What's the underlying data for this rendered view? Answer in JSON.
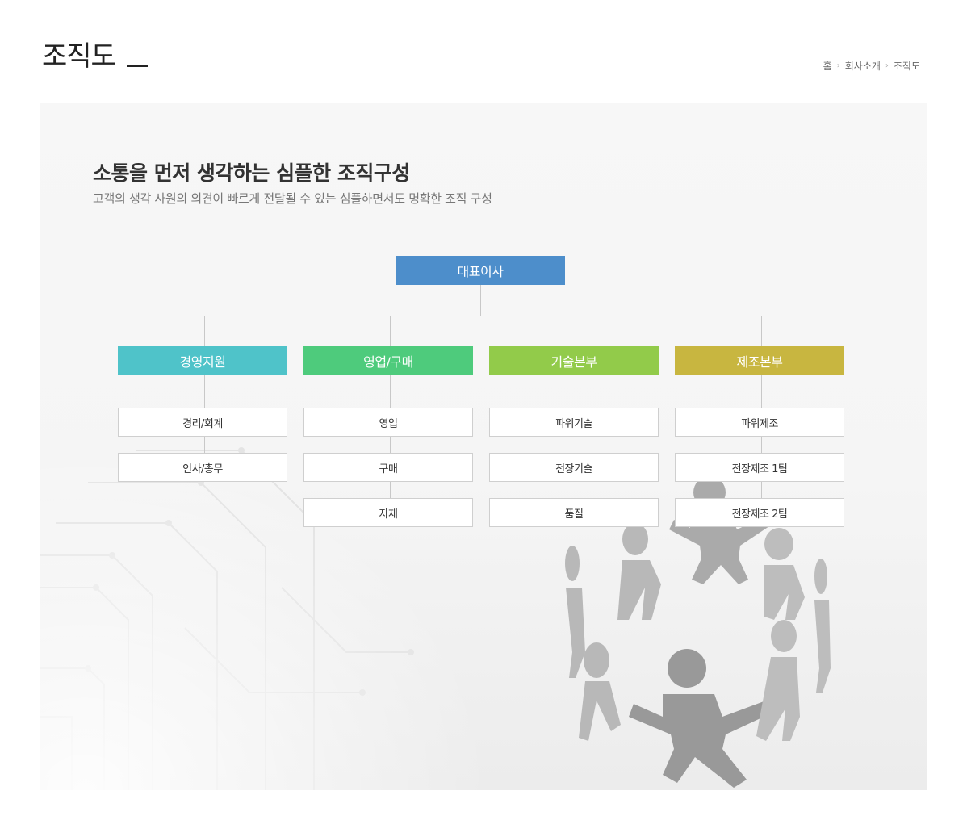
{
  "page": {
    "title": "조직도"
  },
  "breadcrumb": {
    "items": [
      "홈",
      "회사소개",
      "조직도"
    ]
  },
  "intro": {
    "headline": "소통을 먼저 생각하는 심플한 조직구성",
    "subline": "고객의 생각 사원의 의견이 빠르게 전달될 수 있는 심플하면서도 명확한 조직 구성"
  },
  "org": {
    "top": {
      "label": "대표이사",
      "color": "#4d8ecb"
    },
    "departments": [
      {
        "label": "경영지원",
        "color": "#4fc3c9",
        "teams": [
          "경리/회계",
          "인사/총무"
        ]
      },
      {
        "label": "영업/구매",
        "color": "#4ecb7c",
        "teams": [
          "영업",
          "구매",
          "자재"
        ]
      },
      {
        "label": "기술본부",
        "color": "#92cb4a",
        "teams": [
          "파워기술",
          "전장기술",
          "품질"
        ]
      },
      {
        "label": "제조본부",
        "color": "#c8b640",
        "teams": [
          "파워제조",
          "전장제조 1팀",
          "전장제조 2팀"
        ]
      }
    ]
  },
  "colors": {
    "connector": "#c8c8c8",
    "sub_border": "#cfcfcf"
  }
}
